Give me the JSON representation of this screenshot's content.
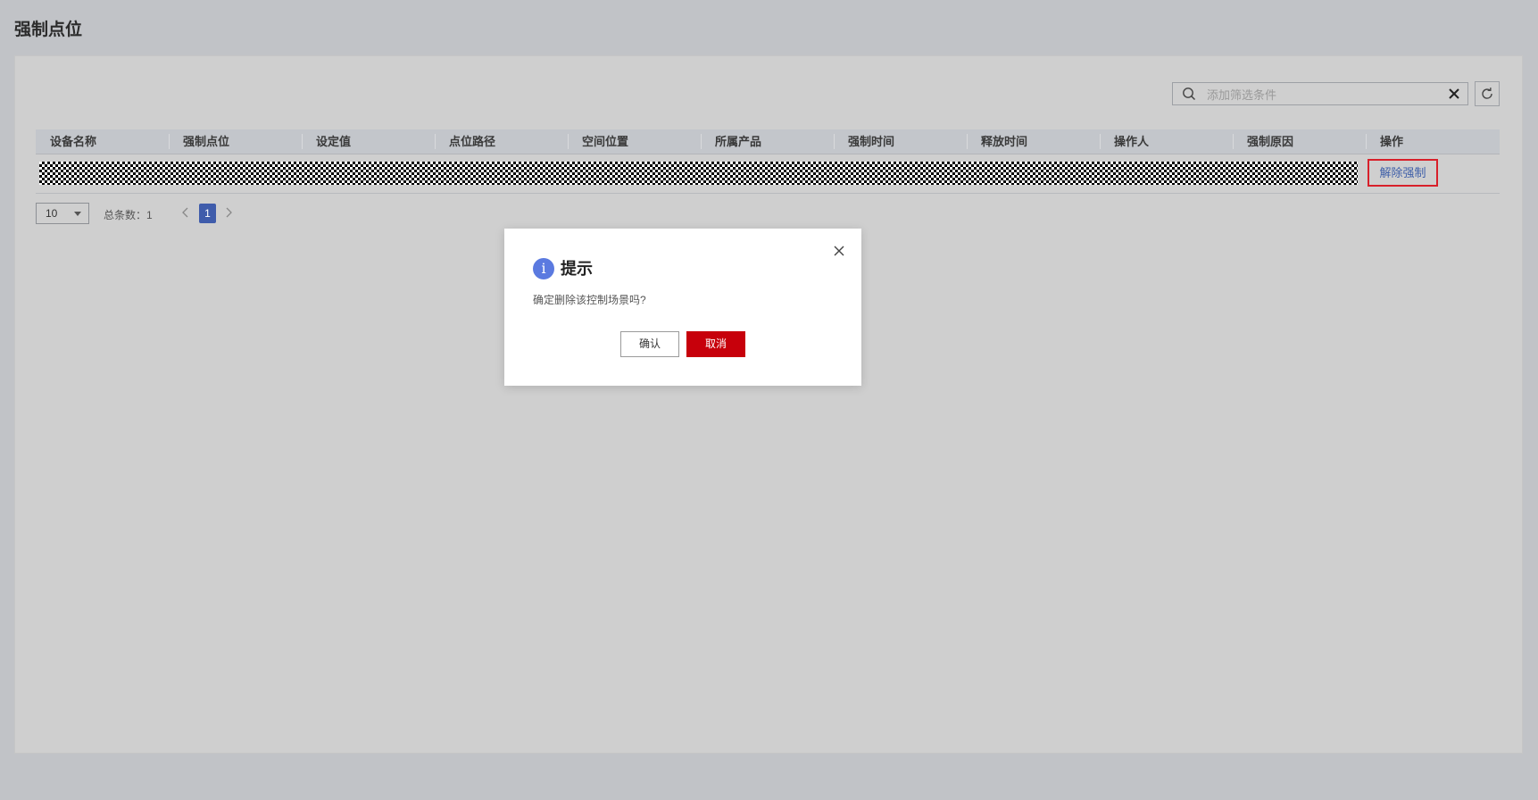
{
  "page": {
    "title": "强制点位"
  },
  "search": {
    "placeholder": "添加筛选条件"
  },
  "table": {
    "columns": [
      "设备名称",
      "强制点位",
      "设定值",
      "点位路径",
      "空间位置",
      "所属产品",
      "强制时间",
      "释放时间",
      "操作人",
      "强制原因",
      "操作"
    ],
    "rows": [
      {
        "action_label": "解除强制"
      }
    ]
  },
  "pagination": {
    "page_size": "10",
    "total_label": "总条数：1",
    "current_page": "1"
  },
  "dialog": {
    "title": "提示",
    "message": "确定删除该控制场景吗?",
    "confirm_label": "确认",
    "cancel_label": "取消",
    "info_glyph": "i"
  },
  "colors": {
    "overlay_bg": "#c1c3c7",
    "primary_red": "#c7000b",
    "highlight_border": "#d8202a",
    "link_blue": "#3d5ea8",
    "info_blue": "#5b7ae0",
    "page_active": "#3f5cab"
  },
  "icons": {
    "search": "search-icon",
    "clear": "clear-icon",
    "refresh": "refresh-icon",
    "close": "close-icon",
    "info": "info-icon",
    "prev": "chevron-left-icon",
    "next": "chevron-right-icon",
    "dropdown": "chevron-down-icon"
  }
}
